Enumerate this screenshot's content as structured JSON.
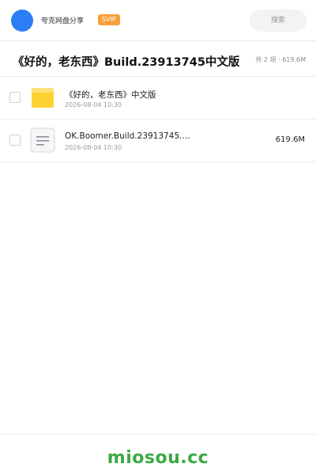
{
  "header": {
    "brand": "夸克网盘分享",
    "badge": "SVIP",
    "search_placeholder": "搜索"
  },
  "share": {
    "title": "《好的，老东西》Build.23913745中文版",
    "summary": "共 2 项 · 619.6M"
  },
  "files": [
    {
      "icon": "folder-icon",
      "name": "《好的，老东西》中文版",
      "date": "2026-08-04 10:30",
      "size": ""
    },
    {
      "icon": "file-icon",
      "name": "OK.Boomer.Build.23913745.…",
      "date": "2026-08-04 10:30",
      "size": "619.6M"
    }
  ],
  "footer": {
    "watermark": "miosou.cc"
  },
  "colors": {
    "accent": "#2b7ef5",
    "svip": "#f6a13b",
    "folder": "#fcc51e",
    "watermark": "#3aa945"
  }
}
